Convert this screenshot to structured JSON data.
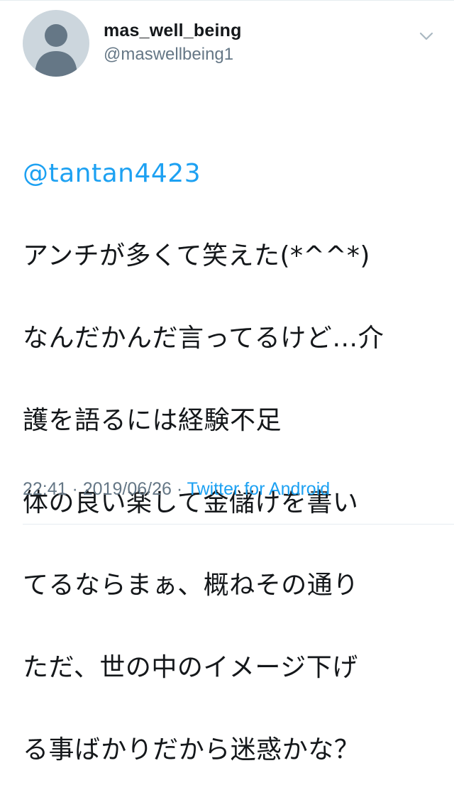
{
  "user": {
    "display_name": "mas_well_being",
    "handle": "@maswellbeing1",
    "avatar_icon": "default-profile-silhouette-icon"
  },
  "menu_icon": "chevron-down-icon",
  "tweet": {
    "mention": "@tantan4423",
    "lines": [
      "アンチが多くて笑えた(*^^*)",
      "なんだかんだ言ってるけど…介",
      "護を語るには経験不足",
      "体の良い楽して金儲けを書い",
      "てるならまぁ、概ねその通り",
      "ただ、世の中のイメージ下げ",
      "る事ばかりだから迷惑かな？"
    ]
  },
  "meta": {
    "time": "22:41",
    "separator_1": " · ",
    "date": "2019/06/26",
    "separator_2": " · ",
    "source": "Twitter for Android"
  },
  "colors": {
    "link": "#1da1f2",
    "secondary_text": "#657786",
    "primary_text": "#14171a",
    "avatar_bg": "#ccd6dd",
    "avatar_fg": "#657786"
  }
}
